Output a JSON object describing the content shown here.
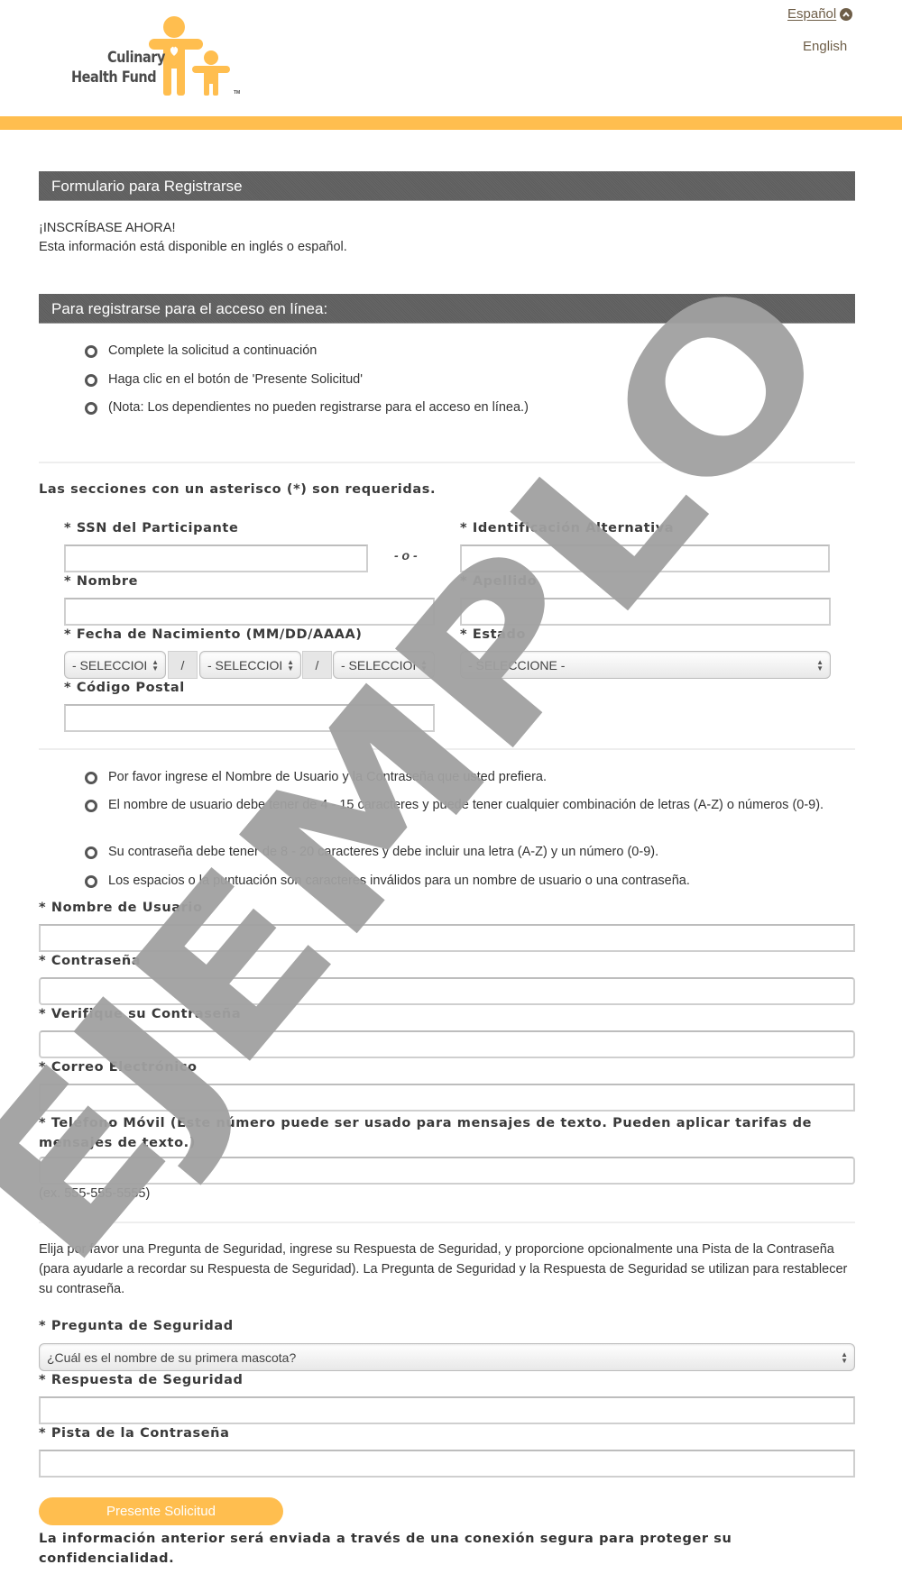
{
  "header": {
    "logo": {
      "line1": "Culinary",
      "line2": "Health Fund",
      "tm": "TM"
    },
    "lang_spanish": "Español",
    "lang_english": "English",
    "colors": {
      "brand_yellow": "#ffbe4f",
      "band_gray": "#5d5d5d",
      "lang_brown": "#6e5e48"
    }
  },
  "section1": {
    "title": "Formulario para Registrarse",
    "line1": "¡INSCRÍBASE AHORA!",
    "line2": "Esta información está disponible en inglés o español."
  },
  "section2": {
    "title": "Para registrarse para el acceso en línea:",
    "bullets": [
      "Complete la solicitud a continuación",
      "Haga clic en el botón de 'Presente Solicitud'",
      "(Nota: Los dependientes no pueden registrarse para el acceso en línea.)"
    ]
  },
  "form": {
    "required_note": "Las secciones con un asterisco (*) son requeridas.",
    "ssn_label": "* SSN del Participante",
    "or_text": "- o -",
    "alt_id_label": "* Identificación Alternativa",
    "first_name_label": "* Nombre",
    "last_name_label": "* Apellido",
    "dob_label": "* Fecha de Nacimiento (MM/DD/AAAA)",
    "dob_month": "- SELECCIONE -",
    "dob_day": "- SELECCIONE -",
    "dob_year": "- SELECCIONE -",
    "dob_month_visible": "- SELECCIOI",
    "dob_day_visible": "- SELECCIOI",
    "dob_year_visible": "- SELECCIOI",
    "dob_sep": "/",
    "state_label": "* Estado",
    "state_value": "- SELECCIONE -",
    "zip_label": "* Código Postal",
    "credential_bullets": [
      "Por favor ingrese el Nombre de Usuario y la Contraseña que usted prefiera.",
      "El nombre de usuario debe tener de 4 - 15 caracteres y puede tener cualquier combinación de letras (A-Z) o números (0-9).",
      "Su contraseña debe tener de 8 - 20 caracteres y debe incluir una letra (A-Z) y un número (0-9).",
      "Los espacios o la puntuación son caracteres inválidos para un nombre de usuario o una contraseña."
    ],
    "username_label": "* Nombre de Usuario",
    "password_label": "* Contraseña",
    "verify_password_label": "* Verifique su Contraseña",
    "email_label": "* Correo Electrónico",
    "mobile_label": "* Teléfono Móvil (Este número puede ser usado para mensajes de texto. Pueden aplicar tarifas de mensajes de texto.)",
    "mobile_hint": "(ex. 555-555-5555)",
    "security_intro": "Elija por favor una Pregunta de Seguridad, ingrese su Respuesta de Seguridad, y proporcione opcionalmente una Pista de la Contraseña (para ayudarle a recordar su Respuesta de Seguridad). La Pregunta de Seguridad y la Respuesta de Seguridad se utilizan para restablecer su contraseña.",
    "security_question_label": "* Pregunta de Seguridad",
    "security_question_value": "¿Cuál es el nombre de su primera mascota?",
    "security_answer_label": "* Respuesta de Seguridad",
    "password_hint_label": "* Pista de la Contraseña",
    "submit_label": "Presente Solicitud",
    "secure_note": "La información anterior será enviada a través de una conexión segura para proteger su confidencialidad."
  },
  "watermark": {
    "text": "EJEMPLO",
    "color": "#a0a0a0"
  }
}
